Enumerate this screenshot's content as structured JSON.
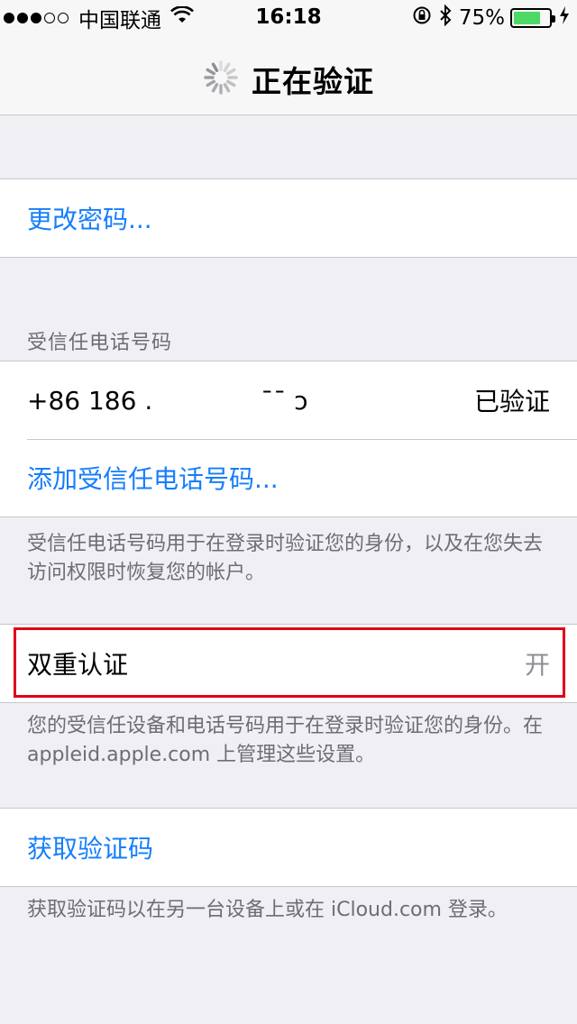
{
  "status_bar": {
    "signal_dots_filled": 3,
    "signal_dots_total": 5,
    "carrier": "中国联通",
    "time": "16:18",
    "battery_percent_text": "75%",
    "battery_level": 0.75,
    "icons": [
      "wifi-icon",
      "orientation-lock-icon",
      "bluetooth-icon",
      "battery-icon",
      "charging-bolt-icon"
    ]
  },
  "nav": {
    "title": "正在验证",
    "spinner_icon": "spinner-icon"
  },
  "sections": {
    "change_password": {
      "label": "更改密码..."
    },
    "trusted_numbers": {
      "header": "受信任电话号码",
      "phone": "+86 186 .",
      "phone_tail": "ˉˉ ɔ",
      "phone_status": "已验证",
      "add_label": "添加受信任电话号码...",
      "footer": "受信任电话号码用于在登录时验证您的身份，以及在您失去访问权限时恢复您的帐户。"
    },
    "two_factor": {
      "label": "双重认证",
      "value": "开",
      "footer": "您的受信任设备和电话号码用于在登录时验证您的身份。在 appleid.apple.com 上管理这些设置。"
    },
    "get_code": {
      "label": "获取验证码",
      "footer": "获取验证码以在另一台设备上或在 iCloud.com 登录。"
    }
  },
  "colors": {
    "link": "#157efb",
    "background": "#efeff4",
    "highlight": "#e0001b",
    "battery": "#4cd964"
  }
}
